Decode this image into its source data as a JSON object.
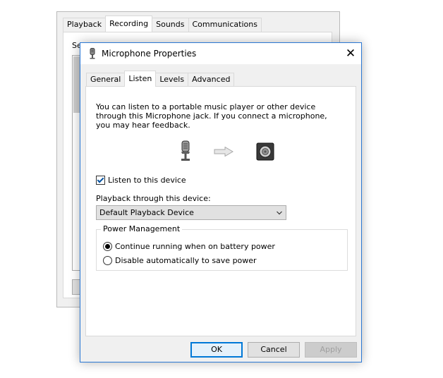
{
  "background_dialog": {
    "tabs": [
      {
        "label": "Playback",
        "active": false
      },
      {
        "label": "Recording",
        "active": true
      },
      {
        "label": "Sounds",
        "active": false
      },
      {
        "label": "Communications",
        "active": false
      }
    ],
    "partial_text": "Sel"
  },
  "dialog": {
    "title": "Microphone Properties",
    "title_icon": "microphone-icon",
    "close_glyph": "✕",
    "tabs": [
      {
        "label": "General",
        "active": false
      },
      {
        "label": "Listen",
        "active": true
      },
      {
        "label": "Levels",
        "active": false
      },
      {
        "label": "Advanced",
        "active": false
      }
    ],
    "listen": {
      "description": "You can listen to a portable music player or other device through this Microphone jack.  If you connect a microphone, you may hear feedback.",
      "illustration": [
        "microphone-icon",
        "arrow-right-icon",
        "speaker-icon"
      ],
      "listen_checkbox": {
        "label": "Listen to this device",
        "checked": true
      },
      "playback_label": "Playback through this device:",
      "playback_select": {
        "value": "Default Playback Device"
      },
      "power_management": {
        "legend": "Power Management",
        "options": [
          {
            "label": "Continue running when on battery power",
            "selected": true
          },
          {
            "label": "Disable automatically to save power",
            "selected": false
          }
        ]
      }
    },
    "buttons": {
      "ok": "OK",
      "cancel": "Cancel",
      "apply": "Apply"
    }
  },
  "colors": {
    "accent": "#0078d7",
    "window_border": "#2b78d4",
    "surface": "#f0f0f0"
  }
}
